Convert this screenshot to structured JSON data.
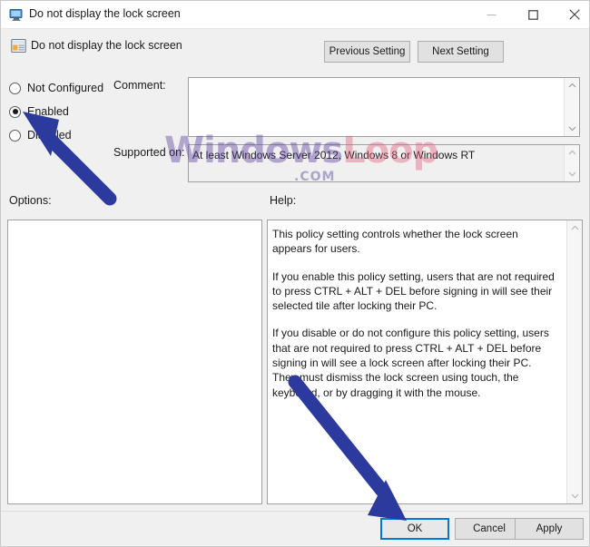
{
  "window": {
    "title": "Do not display the lock screen",
    "title_icon": "policy-window-icon",
    "controls": {
      "minimize": "minimize-icon",
      "maximize": "maximize-icon",
      "close": "close-icon"
    }
  },
  "header": {
    "icon": "group-policy-setting-icon",
    "policy_title": "Do not display the lock screen",
    "previous_setting_label": "Previous Setting",
    "next_setting_label": "Next Setting"
  },
  "state": {
    "options": [
      {
        "id": "not-configured",
        "label": "Not Configured",
        "selected": false
      },
      {
        "id": "enabled",
        "label": "Enabled",
        "selected": true
      },
      {
        "id": "disabled",
        "label": "Disabled",
        "selected": false
      }
    ],
    "comment_label": "Comment:",
    "comment_value": "",
    "supported_on_label": "Supported on:",
    "supported_on_value": "At least Windows Server 2012, Windows 8 or Windows RT"
  },
  "panels": {
    "options_label": "Options:",
    "options_content": "",
    "help_label": "Help:",
    "help_paragraphs": [
      "This policy setting controls whether the lock screen appears for users.",
      "If you enable this policy setting, users that are not required to press CTRL + ALT + DEL before signing in will see their selected tile after locking their PC.",
      "If you disable or do not configure this policy setting, users that are not required to press CTRL + ALT + DEL before signing in will see a lock screen after locking their PC. They must dismiss the lock screen using touch, the keyboard, or by dragging it with the mouse."
    ]
  },
  "footer": {
    "ok_label": "OK",
    "cancel_label": "Cancel",
    "apply_label": "Apply"
  },
  "watermark": {
    "part_one": "Windows",
    "part_two": "Loop",
    "sub": ".COM"
  },
  "annotations": {
    "arrow_color": "#2b3a9c",
    "arrow_one_target": "enabled-radio-button",
    "arrow_two_target": "ok-button"
  },
  "colors": {
    "accent": "#0078d7",
    "window_bg": "#f0f0f0",
    "panel_bg": "#ffffff",
    "border": "#a0a0a0",
    "arrow": "#2b3a9c"
  }
}
